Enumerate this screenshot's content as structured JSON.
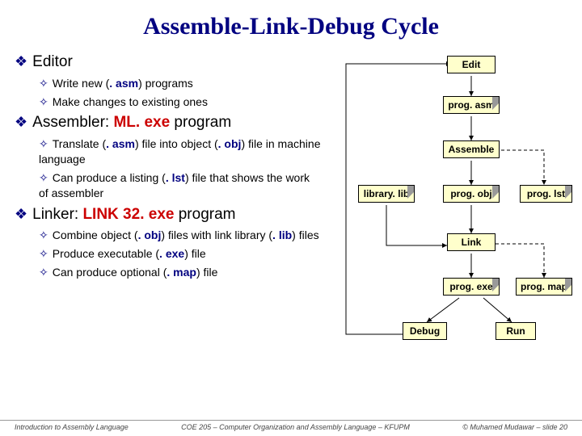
{
  "title": "Assemble-Link-Debug Cycle",
  "sections": [
    {
      "head": "Editor",
      "hl": "",
      "items": [
        {
          "pre": "Write new (",
          "hl": ". asm",
          "post": ") programs"
        },
        {
          "pre": "Make changes to existing ones",
          "hl": "",
          "post": ""
        }
      ]
    },
    {
      "head": "Assembler: ",
      "hl": "ML. exe",
      "tail": " program",
      "items": [
        {
          "pre": "Translate (",
          "hl": ". asm",
          "post": ") file into object (",
          "hl2": ". obj",
          "post2": ") file in machine language"
        },
        {
          "pre": "Can produce a listing (",
          "hl": ". lst",
          "post": ") file that shows the work of assembler"
        }
      ]
    },
    {
      "head": "Linker: ",
      "hl": "LINK 32. exe",
      "tail": " program",
      "items": [
        {
          "pre": "Combine object (",
          "hl": ". obj",
          "post": ") files with link library (",
          "hl2": ". lib",
          "post2": ") files"
        },
        {
          "pre": "Produce executable (",
          "hl": ". exe",
          "post": ") file"
        },
        {
          "pre": "Can produce optional (",
          "hl": ". map",
          "post": ") file"
        }
      ]
    }
  ],
  "boxes": {
    "edit": "Edit",
    "prog_asm": "prog. asm",
    "assemble": "Assemble",
    "library_lib": "library. lib",
    "prog_obj": "prog. obj",
    "prog_lst": "prog. lst",
    "link": "Link",
    "prog_exe": "prog. exe",
    "prog_map": "prog. map",
    "debug": "Debug",
    "run": "Run"
  },
  "footer": {
    "left": "Introduction to Assembly Language",
    "center": "COE 205 – Computer Organization and Assembly Language – KFUPM",
    "right": "© Muhamed Mudawar – slide 20"
  }
}
